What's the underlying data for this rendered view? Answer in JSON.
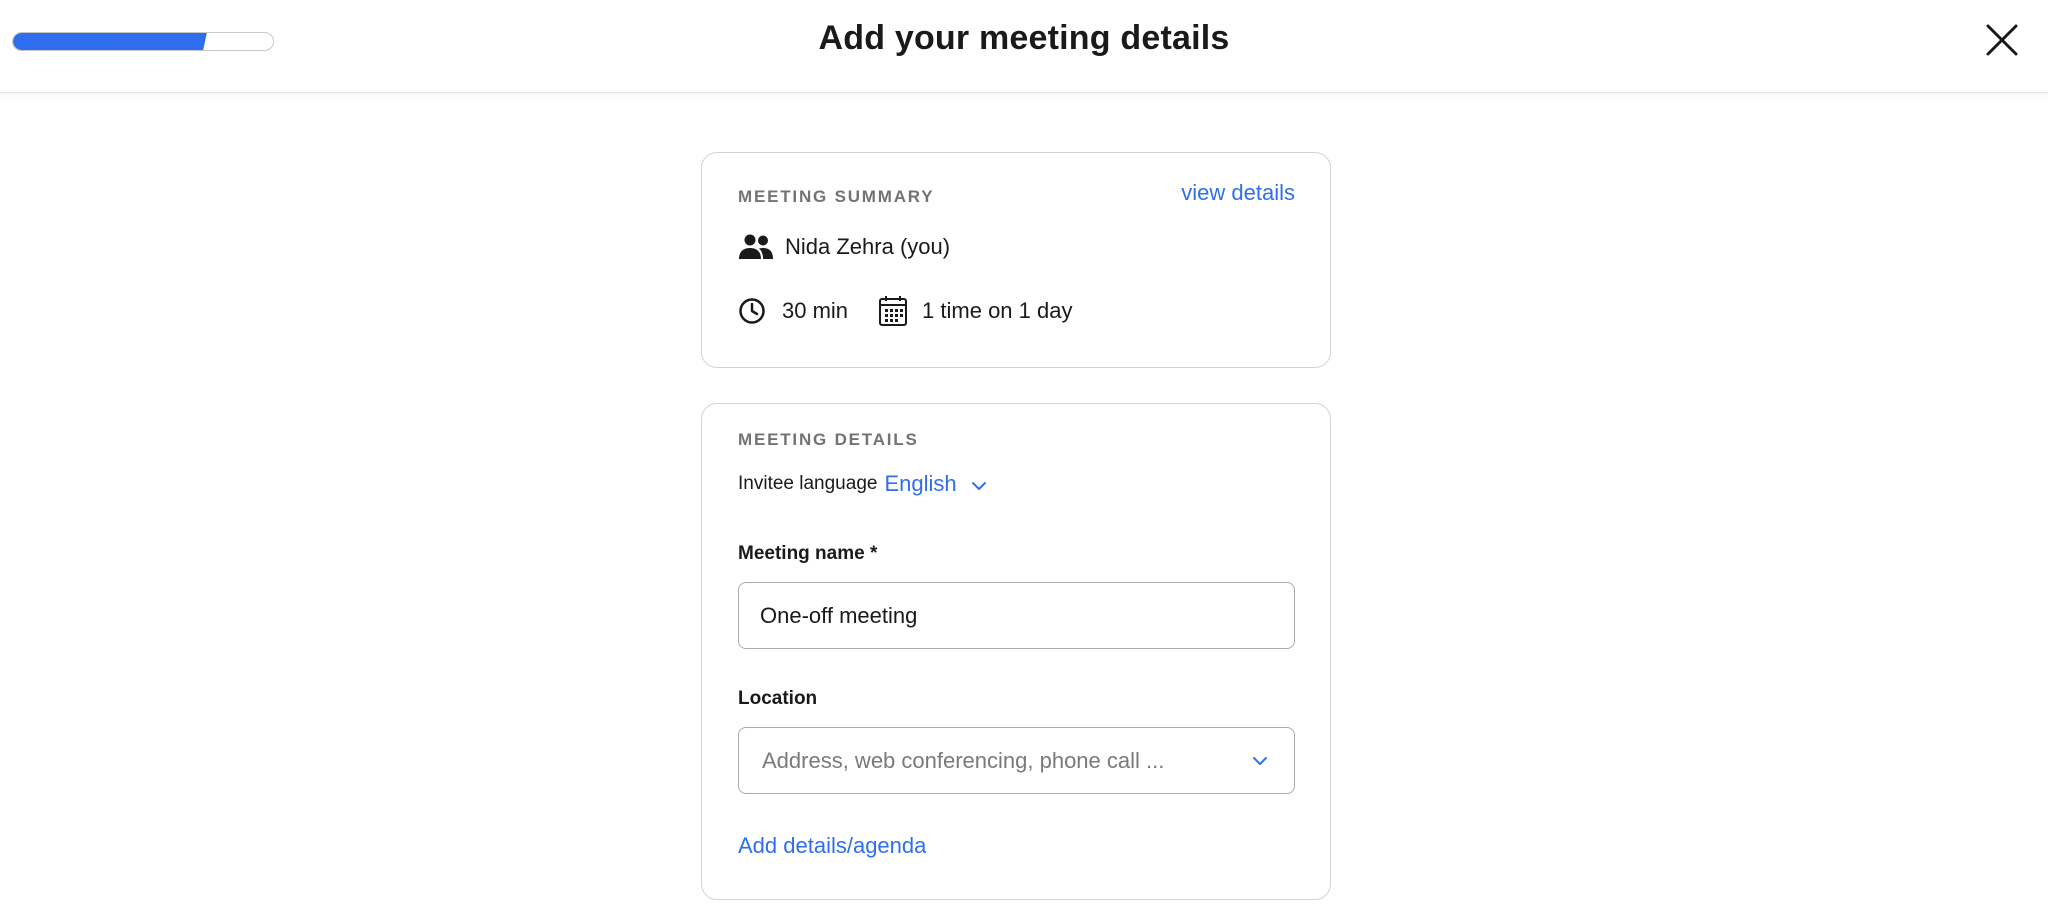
{
  "header": {
    "title": "Add your meeting details",
    "progress_percent": 68,
    "progress_steps_completed": 2,
    "accent_color": "#2f6fed"
  },
  "summary": {
    "section_label": "MEETING SUMMARY",
    "view_details": "view details",
    "host": "Nida Zehra (you)",
    "duration": "30 min",
    "frequency": "1 time on 1 day",
    "icons": [
      "people-icon",
      "clock-icon",
      "calendar-icon"
    ]
  },
  "details": {
    "section_label": "MEETING DETAILS",
    "invitee_language_label": "Invitee language",
    "invitee_language_value": "English",
    "meeting_name_label": "Meeting name *",
    "meeting_name_value": "One-off meeting",
    "location_label": "Location",
    "location_placeholder": "Address, web conferencing, phone call ...",
    "add_details": "Add details/agenda"
  }
}
